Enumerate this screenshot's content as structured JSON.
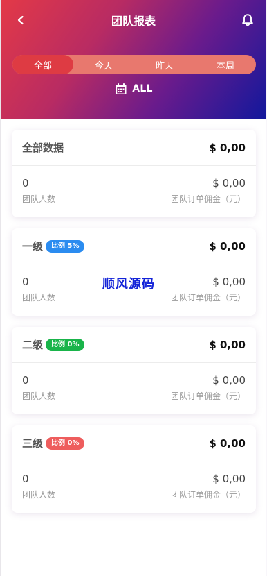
{
  "header": {
    "title": "团队报表",
    "back_icon": "chevron-left-icon",
    "bell_icon": "bell-icon"
  },
  "tabs": [
    {
      "label": "全部",
      "active": true
    },
    {
      "label": "今天",
      "active": false
    },
    {
      "label": "昨天",
      "active": false
    },
    {
      "label": "本周",
      "active": false
    }
  ],
  "date_filter": {
    "icon": "calendar-icon",
    "label": "ALL"
  },
  "colors": {
    "accent": "#de3b43",
    "level1": "#2b8cf0",
    "level2": "#19b44a",
    "level3": "#ee5d5d"
  },
  "cards": [
    {
      "title": "全部数据",
      "badge": "",
      "amount": "$ 0,00",
      "members": "0",
      "members_label": "团队人数",
      "commission": "$ 0,00",
      "commission_label": "团队订单佣金（元）"
    },
    {
      "title": "一级",
      "badge": "比例 5%",
      "amount": "$ 0,00",
      "members": "0",
      "members_label": "团队人数",
      "commission": "$ 0,00",
      "commission_label": "团队订单佣金（元）"
    },
    {
      "title": "二级",
      "badge": "比例 0%",
      "amount": "$ 0,00",
      "members": "0",
      "members_label": "团队人数",
      "commission": "$ 0,00",
      "commission_label": "团队订单佣金（元）"
    },
    {
      "title": "三级",
      "badge": "比例 0%",
      "amount": "$ 0,00",
      "members": "0",
      "members_label": "团队人数",
      "commission": "$ 0,00",
      "commission_label": "团队订单佣金（元）"
    }
  ],
  "watermark": "顺风源码"
}
